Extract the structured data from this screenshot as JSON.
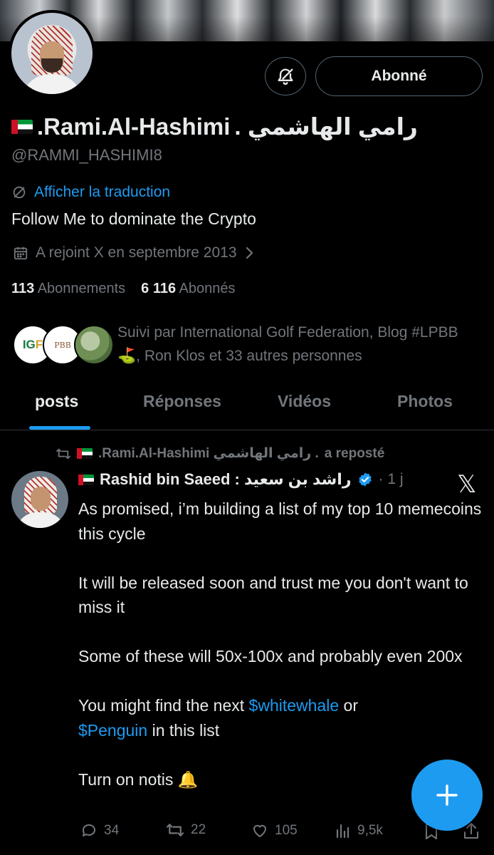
{
  "profile": {
    "name_latin": ".Rami.Al-Hashimi",
    "name_arabic": "رامي الهاشمي .",
    "handle": "@RAMMI_HASHIMI8",
    "translate_label": "Afficher la traduction",
    "bio": "Follow Me to dominate the Crypto",
    "joined": "A rejoint X en septembre 2013",
    "following_count": "113",
    "following_label": "Abonnements",
    "followers_count": "6 116",
    "followers_label": "Abonnés",
    "follow_button": "Abonné",
    "followed_by_text": "Suivi par International Golf Federation, Blog #LPBB⛳, Ron Klos et 33 autres personnes",
    "mini_avatars": [
      "IGF",
      "PBB",
      "Ron Klos"
    ]
  },
  "tabs": [
    "posts",
    "Réponses",
    "Vidéos",
    "Photos"
  ],
  "active_tab": "posts",
  "post": {
    "repost_name": ".Rami.Al-Hashimi رامي الهاشمي .",
    "repost_suffix": "a reposté",
    "author": "Rashid bin Saeed : راشد بن سعيد",
    "time": "· 1 j",
    "body": {
      "p1": "As promised, i’m building a list of my top 10 memecoins this cycle",
      "p2": "It will be released soon and trust me you don't want to miss it",
      "p3": "Some of these will 50x-100x and probably even 200x",
      "p4_pre": "You might find the next ",
      "p4_cash1": "$whitewhale",
      "p4_mid": " or",
      "p4_cash2": "$Penguin",
      "p4_post": " in this list",
      "p5": "Turn on notis 🔔"
    },
    "actions": {
      "replies": "34",
      "reposts": "22",
      "likes": "105",
      "views": "9,5k"
    }
  },
  "colors": {
    "background": "#000000",
    "accent": "#1d9bf0",
    "muted": "#71767b",
    "text": "#e7e9ea",
    "border": "#2f3336"
  }
}
